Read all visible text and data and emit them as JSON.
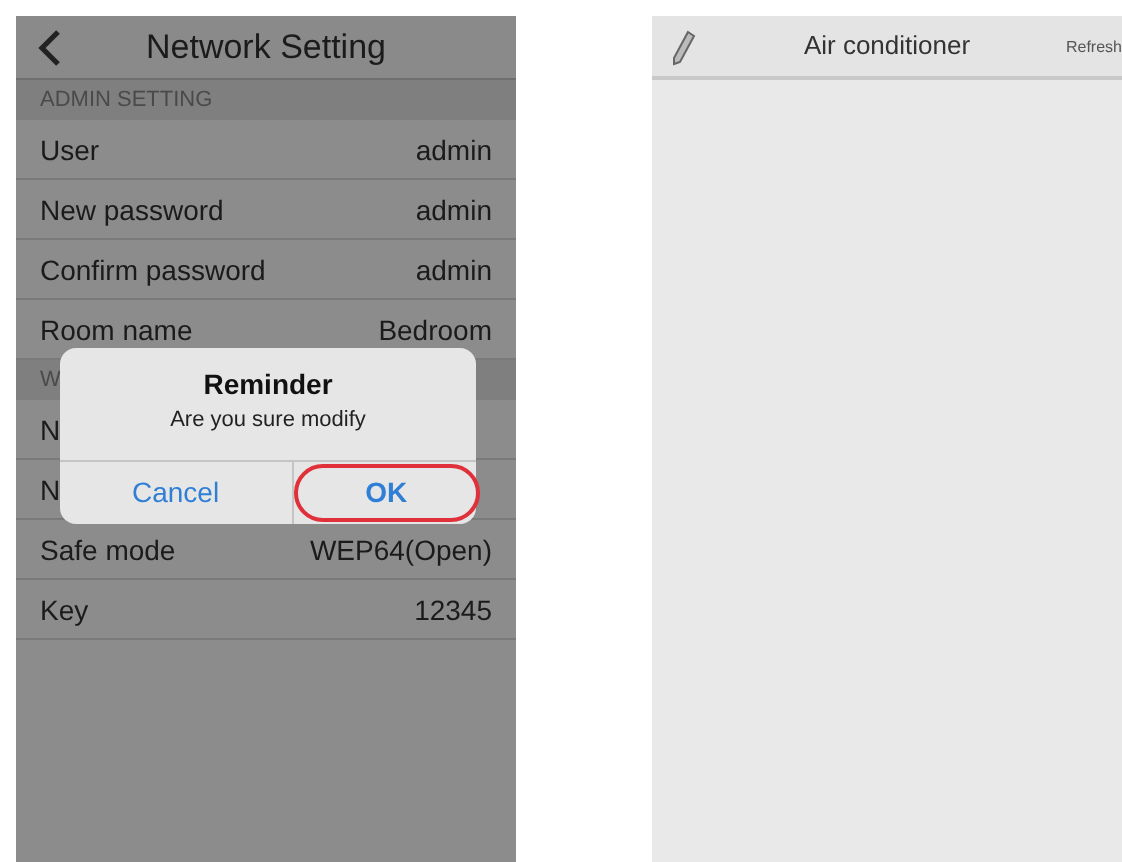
{
  "settings_screen": {
    "title": "Network Setting",
    "sections": [
      {
        "header": "ADMIN SETTING",
        "rows": [
          {
            "label": "User",
            "value": "admin"
          },
          {
            "label": "New password",
            "value": "admin"
          },
          {
            "label": "Confirm password",
            "value": "admin"
          },
          {
            "label": "Room name",
            "value": "Bedroom"
          }
        ]
      },
      {
        "header": "W",
        "rows": [
          {
            "label": "N",
            "value": ""
          },
          {
            "label": "N",
            "value": ""
          },
          {
            "label": "Safe mode",
            "value": "WEP64(Open)"
          },
          {
            "label": "Key",
            "value": "12345"
          }
        ]
      }
    ],
    "dialog": {
      "title": "Reminder",
      "message": "Are you sure modify",
      "buttons": [
        {
          "label": "Cancel",
          "highlighted": false
        },
        {
          "label": "OK",
          "highlighted": true
        }
      ]
    }
  },
  "device_screen": {
    "title": "Air conditioner",
    "action": "Refresh"
  }
}
